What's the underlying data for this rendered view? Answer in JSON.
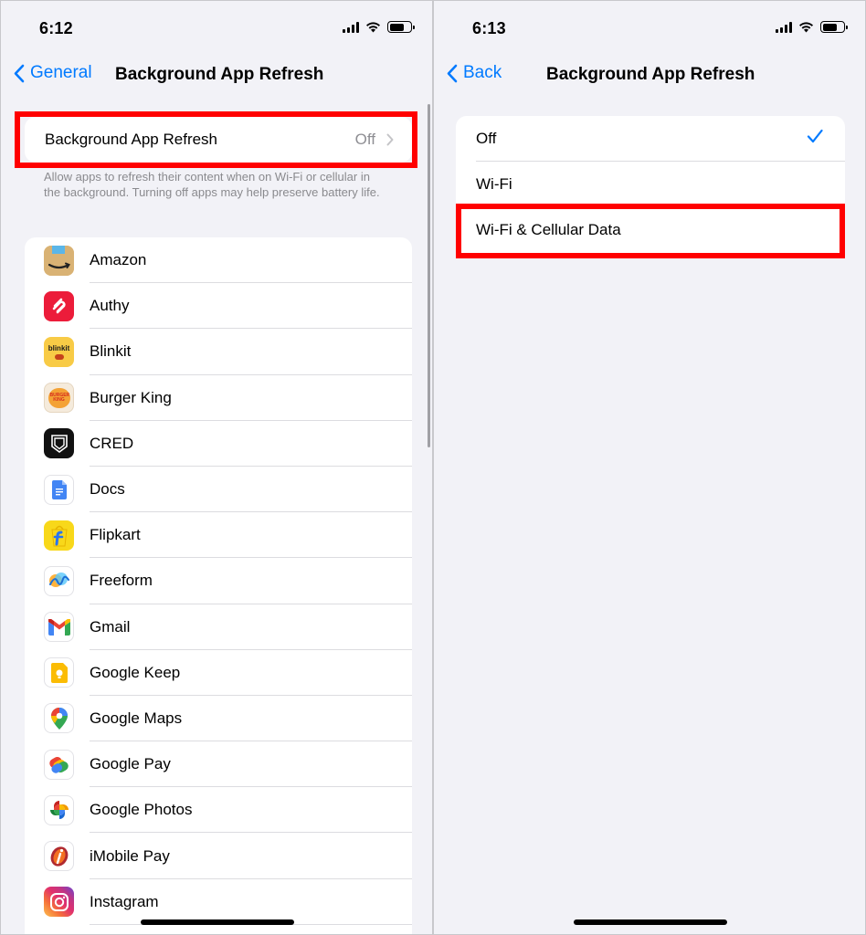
{
  "left": {
    "status": {
      "time": "6:12"
    },
    "nav": {
      "back_label": "General",
      "title": "Background App Refresh"
    },
    "setting": {
      "label": "Background App Refresh",
      "value": "Off"
    },
    "footer": "Allow apps to refresh their content when on Wi-Fi or cellular in the background. Turning off apps may help preserve battery life.",
    "apps": [
      {
        "name": "Amazon",
        "icon": "amazon-icon"
      },
      {
        "name": "Authy",
        "icon": "authy-icon"
      },
      {
        "name": "Blinkit",
        "icon": "blinkit-icon"
      },
      {
        "name": "Burger King",
        "icon": "burger-king-icon"
      },
      {
        "name": "CRED",
        "icon": "cred-icon"
      },
      {
        "name": "Docs",
        "icon": "docs-icon"
      },
      {
        "name": "Flipkart",
        "icon": "flipkart-icon"
      },
      {
        "name": "Freeform",
        "icon": "freeform-icon"
      },
      {
        "name": "Gmail",
        "icon": "gmail-icon"
      },
      {
        "name": "Google Keep",
        "icon": "google-keep-icon"
      },
      {
        "name": "Google Maps",
        "icon": "google-maps-icon"
      },
      {
        "name": "Google Pay",
        "icon": "google-pay-icon"
      },
      {
        "name": "Google Photos",
        "icon": "google-photos-icon"
      },
      {
        "name": "iMobile Pay",
        "icon": "imobile-pay-icon"
      },
      {
        "name": "Instagram",
        "icon": "instagram-icon"
      }
    ],
    "icon_text": {
      "blinkit": "blinkit",
      "burger_king": "BURGER KING"
    }
  },
  "right": {
    "status": {
      "time": "6:13"
    },
    "nav": {
      "back_label": "Back",
      "title": "Background App Refresh"
    },
    "options": [
      {
        "label": "Off",
        "selected": true
      },
      {
        "label": "Wi-Fi",
        "selected": false
      },
      {
        "label": "Wi-Fi & Cellular Data",
        "selected": false
      }
    ]
  },
  "colors": {
    "accent": "#007aff",
    "highlight": "#ff0000",
    "background": "#f2f2f7"
  }
}
